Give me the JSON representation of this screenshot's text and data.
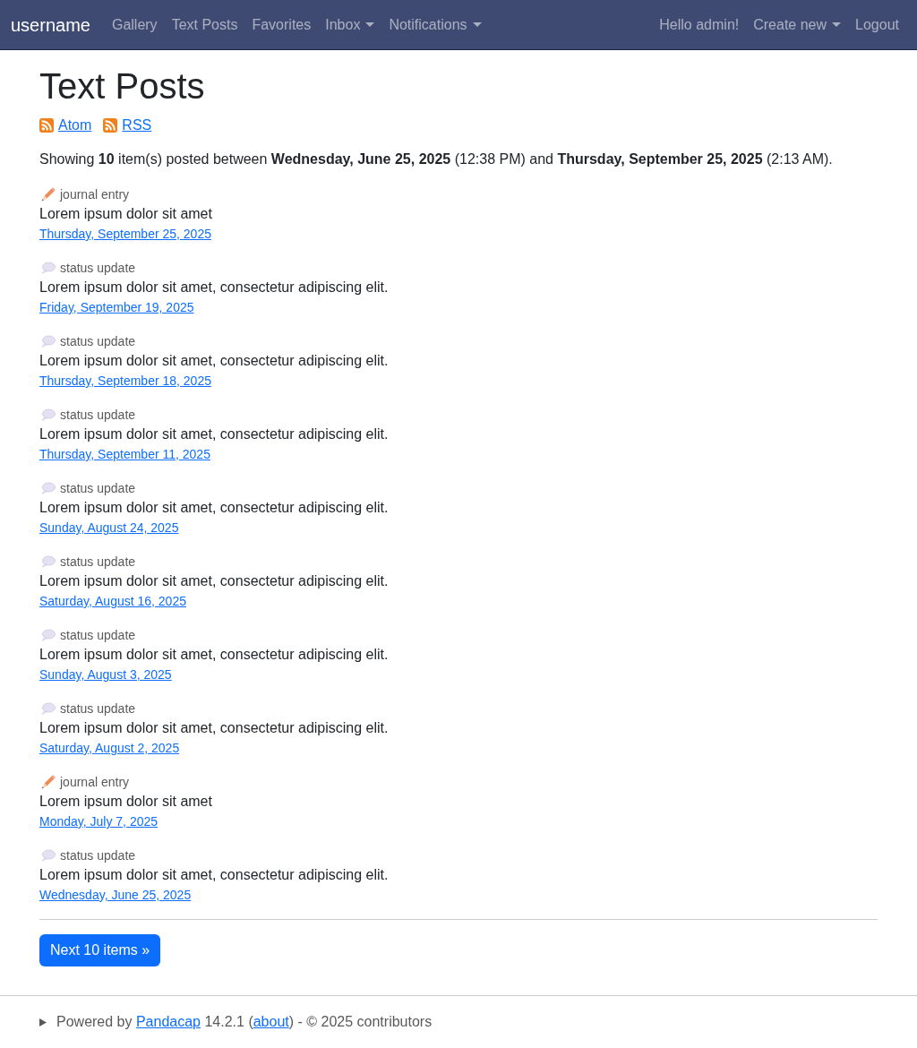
{
  "navbar": {
    "brand": "username",
    "links": [
      {
        "label": "Gallery",
        "kind": "link"
      },
      {
        "label": "Text Posts",
        "kind": "link"
      },
      {
        "label": "Favorites",
        "kind": "link"
      },
      {
        "label": "Inbox",
        "kind": "dropdown"
      },
      {
        "label": "Notifications",
        "kind": "dropdown"
      }
    ],
    "right": [
      {
        "label": "Hello admin!",
        "kind": "text"
      },
      {
        "label": "Create new",
        "kind": "dropdown"
      },
      {
        "label": "Logout",
        "kind": "link"
      }
    ]
  },
  "page": {
    "title": "Text Posts",
    "feeds": [
      "Atom",
      "RSS"
    ],
    "summary": "Showing **10** item(s) posted between **Wednesday, June 25, 2025** (12:38 PM) and **Thursday, September 25, 2025** (2:13 AM)."
  },
  "posts": [
    {
      "kind": "journal",
      "type_label": "journal entry",
      "text": "Lorem ipsum dolor sit amet",
      "date": "Thursday, September 25, 2025"
    },
    {
      "kind": "status",
      "type_label": "status update",
      "text": "Lorem ipsum dolor sit amet, consectetur adipiscing elit.",
      "date": "Friday, September 19, 2025"
    },
    {
      "kind": "status",
      "type_label": "status update",
      "text": "Lorem ipsum dolor sit amet, consectetur adipiscing elit.",
      "date": "Thursday, September 18, 2025"
    },
    {
      "kind": "status",
      "type_label": "status update",
      "text": "Lorem ipsum dolor sit amet, consectetur adipiscing elit.",
      "date": "Thursday, September 11, 2025"
    },
    {
      "kind": "status",
      "type_label": "status update",
      "text": "Lorem ipsum dolor sit amet, consectetur adipiscing elit.",
      "date": "Sunday, August 24, 2025"
    },
    {
      "kind": "status",
      "type_label": "status update",
      "text": "Lorem ipsum dolor sit amet, consectetur adipiscing elit.",
      "date": "Saturday, August 16, 2025"
    },
    {
      "kind": "status",
      "type_label": "status update",
      "text": "Lorem ipsum dolor sit amet, consectetur adipiscing elit.",
      "date": "Sunday, August 3, 2025"
    },
    {
      "kind": "status",
      "type_label": "status update",
      "text": "Lorem ipsum dolor sit amet, consectetur adipiscing elit.",
      "date": "Saturday, August 2, 2025"
    },
    {
      "kind": "journal",
      "type_label": "journal entry",
      "text": "Lorem ipsum dolor sit amet",
      "date": "Monday, July 7, 2025"
    },
    {
      "kind": "status",
      "type_label": "status update",
      "text": "Lorem ipsum dolor sit amet, consectetur adipiscing elit.",
      "date": "Wednesday, June 25, 2025"
    }
  ],
  "next_button": "Next 10 items »",
  "footer": {
    "expanded": false,
    "parts": [
      {
        "kind": "text",
        "text": "Powered by "
      },
      {
        "kind": "link",
        "text": "Pandacap"
      },
      {
        "kind": "text",
        "text": " 14.2.1 ("
      },
      {
        "kind": "link",
        "text": "about"
      },
      {
        "kind": "text",
        "text": ") - © 2025 contributors"
      }
    ]
  }
}
